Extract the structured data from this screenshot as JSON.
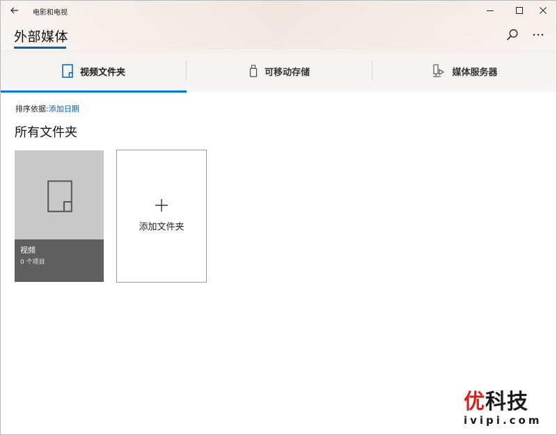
{
  "window": {
    "app_title": "电影和电视",
    "controls": {
      "minimize": "minimize-icon",
      "maximize": "maximize-icon",
      "close": "close-icon"
    }
  },
  "header": {
    "title": "外部媒体",
    "search_icon": "search-icon",
    "more_icon": "more-icon"
  },
  "tabs": [
    {
      "label": "视频文件夹",
      "icon": "video-folder-icon",
      "active": true
    },
    {
      "label": "可移动存储",
      "icon": "usb-drive-icon",
      "active": false
    },
    {
      "label": "媒体服务器",
      "icon": "media-server-icon",
      "active": false
    }
  ],
  "sort": {
    "label": "排序依据:",
    "value": "添加日期"
  },
  "section": {
    "title": "所有文件夹"
  },
  "folders": [
    {
      "name": "视频",
      "count": "0 个项目",
      "icon": "folder-icon"
    }
  ],
  "add_folder": {
    "label": "添加文件夹",
    "icon": "plus-icon"
  },
  "watermark": {
    "text": "优科技",
    "url": "ivipi.com"
  },
  "colors": {
    "accent": "#0078d4",
    "link": "#005fb8",
    "tile_bg": "#c8c8c8",
    "tile_footer": "#5f5f5f",
    "watermark_red": "#d6221e"
  }
}
